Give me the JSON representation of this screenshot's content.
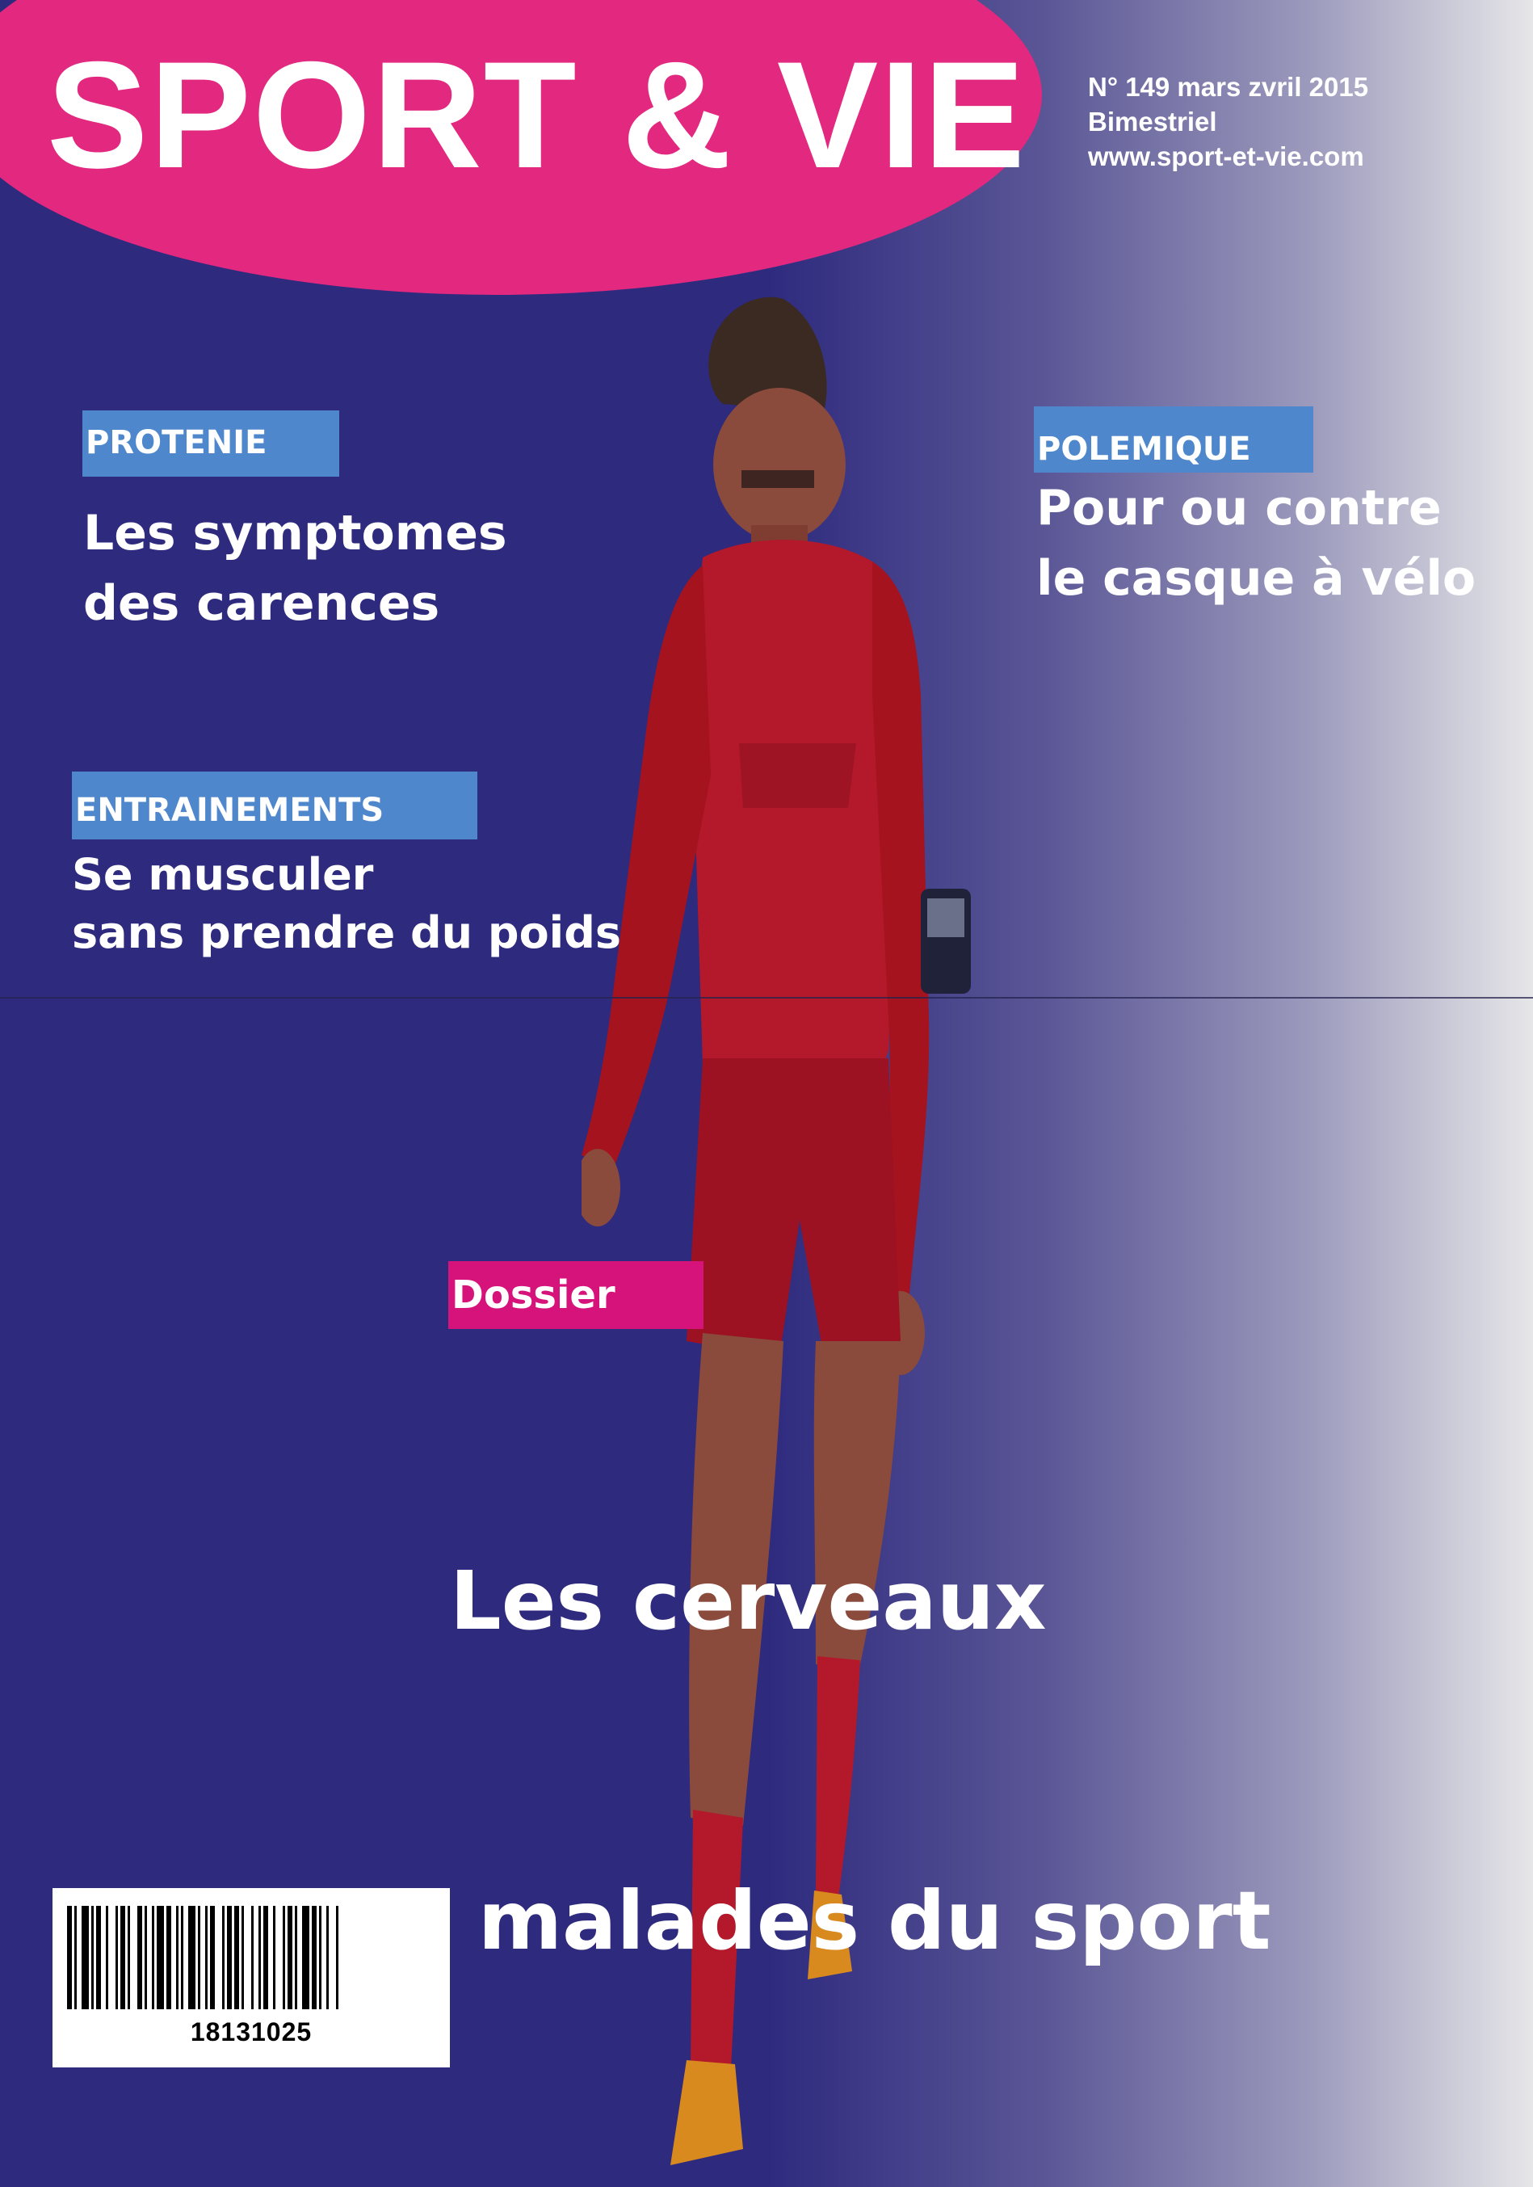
{
  "masthead": {
    "title": "SPORT & VIE",
    "issue_line": "N° 149 mars zvril 2015",
    "frequency": "Bimestriel",
    "website": "www.sport-et-vie.com"
  },
  "stories": {
    "protenie": {
      "kicker": "PROTENIE",
      "lines": [
        "Les symptomes",
        "des carences"
      ]
    },
    "polemique": {
      "kicker": "POLEMIQUE",
      "lines": [
        "Pour ou contre",
        "le casque à vélo"
      ]
    },
    "entrainements": {
      "kicker": "ENTRAINEMENTS",
      "lines": [
        "Se musculer",
        "sans prendre du poids"
      ]
    },
    "dossier": {
      "kicker": "Dossier",
      "lines": [
        "Les cerveaux",
        " malades du sport"
      ]
    }
  },
  "barcode": {
    "number": "18131025"
  },
  "colors": {
    "masthead_pink": "#e2297f",
    "kicker_blue": "#4f87cc",
    "kicker_pink": "#d6137a",
    "background_blue": "#2e2a7e",
    "jersey_red": "#b3192a"
  },
  "cover_image": "footballer-in-red-kit"
}
